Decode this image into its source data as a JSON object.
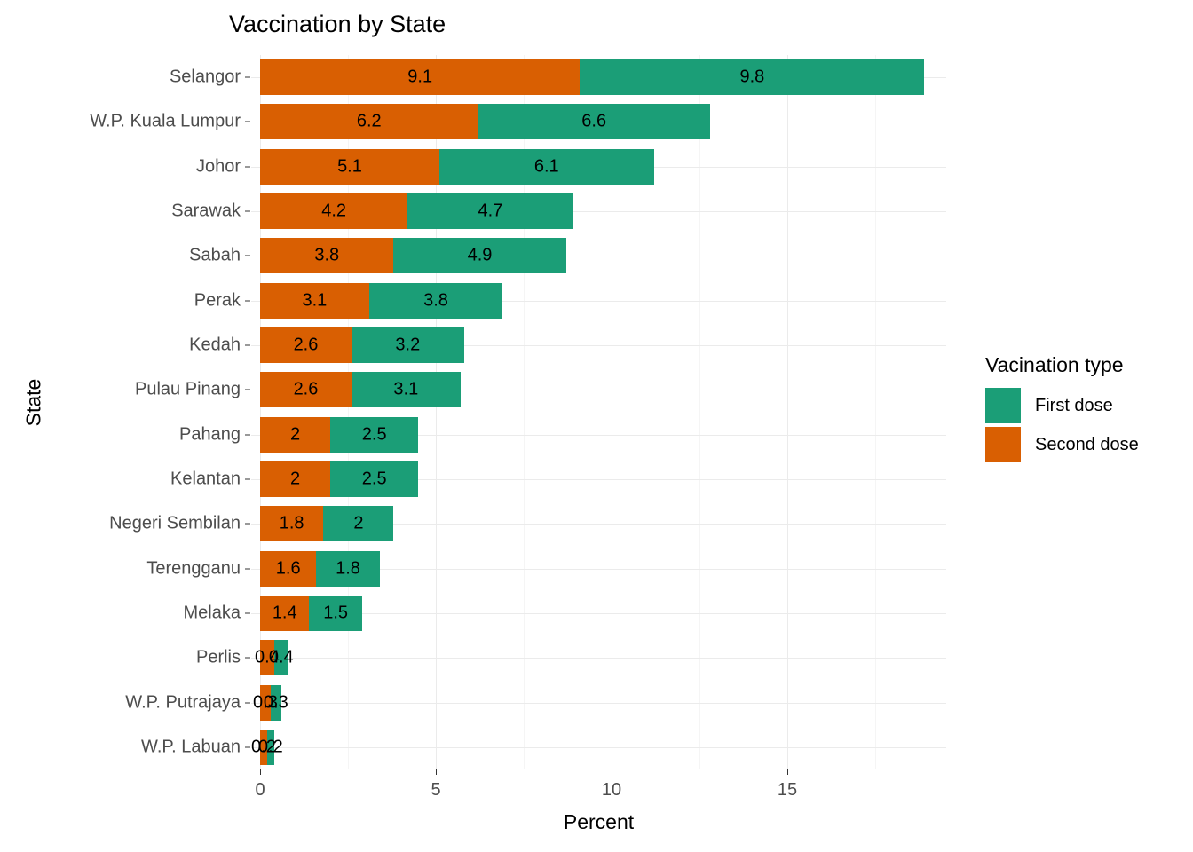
{
  "chart_data": {
    "type": "bar",
    "title": "Vaccination by State",
    "xlabel": "Percent",
    "ylabel": "State",
    "orientation": "horizontal",
    "stacked": true,
    "grid": true,
    "legend_position": "right",
    "legend_title": "Vacination type",
    "xlim": [
      0,
      19.8
    ],
    "xticks": [
      0,
      5,
      10,
      15
    ],
    "xtick_labels": [
      "0",
      "5",
      "10",
      "15"
    ],
    "colors": {
      "first_dose": "#1B9E77",
      "second_dose": "#D95F02",
      "panel_background": "#FFFFFF",
      "gridline_major": "#EBEBEB",
      "gridline_minor": "#F5F5F5",
      "axis_text": "#4D4D4D",
      "label_text": "#000000"
    },
    "categories": [
      "Selangor",
      "W.P. Kuala Lumpur",
      "Johor",
      "Sarawak",
      "Sabah",
      "Perak",
      "Kedah",
      "Pulau Pinang",
      "Pahang",
      "Kelantan",
      "Negeri Sembilan",
      "Terengganu",
      "Melaka",
      "Perlis",
      "W.P. Putrajaya",
      "W.P. Labuan"
    ],
    "series": [
      {
        "name": "Second dose",
        "color": "#D95F02",
        "values": [
          9.1,
          6.2,
          5.1,
          4.2,
          3.8,
          3.1,
          2.6,
          2.6,
          2,
          2,
          1.8,
          1.6,
          1.4,
          0.4,
          0.3,
          0.2
        ],
        "labels": [
          "9.1",
          "6.2",
          "5.1",
          "4.2",
          "3.8",
          "3.1",
          "2.6",
          "2.6",
          "2",
          "2",
          "1.8",
          "1.6",
          "1.4",
          "0.4",
          "0.3",
          "0.2"
        ]
      },
      {
        "name": "First dose",
        "color": "#1B9E77",
        "values": [
          9.8,
          6.6,
          6.1,
          4.7,
          4.9,
          3.8,
          3.2,
          3.1,
          2.5,
          2.5,
          2,
          1.8,
          1.5,
          0.4,
          0.3,
          0.2
        ],
        "labels": [
          "9.8",
          "6.6",
          "6.1",
          "4.7",
          "4.9",
          "3.8",
          "3.2",
          "3.1",
          "2.5",
          "2.5",
          "2",
          "1.8",
          "1.5",
          "0.4",
          "0.3",
          "0.2"
        ]
      }
    ]
  },
  "legend": {
    "title": "Vacination type",
    "items": [
      {
        "label": "First dose",
        "color": "#1B9E77"
      },
      {
        "label": "Second dose",
        "color": "#D95F02"
      }
    ]
  },
  "axes": {
    "x_title": "Percent",
    "y_title": "State"
  },
  "title": "Vaccination by State"
}
